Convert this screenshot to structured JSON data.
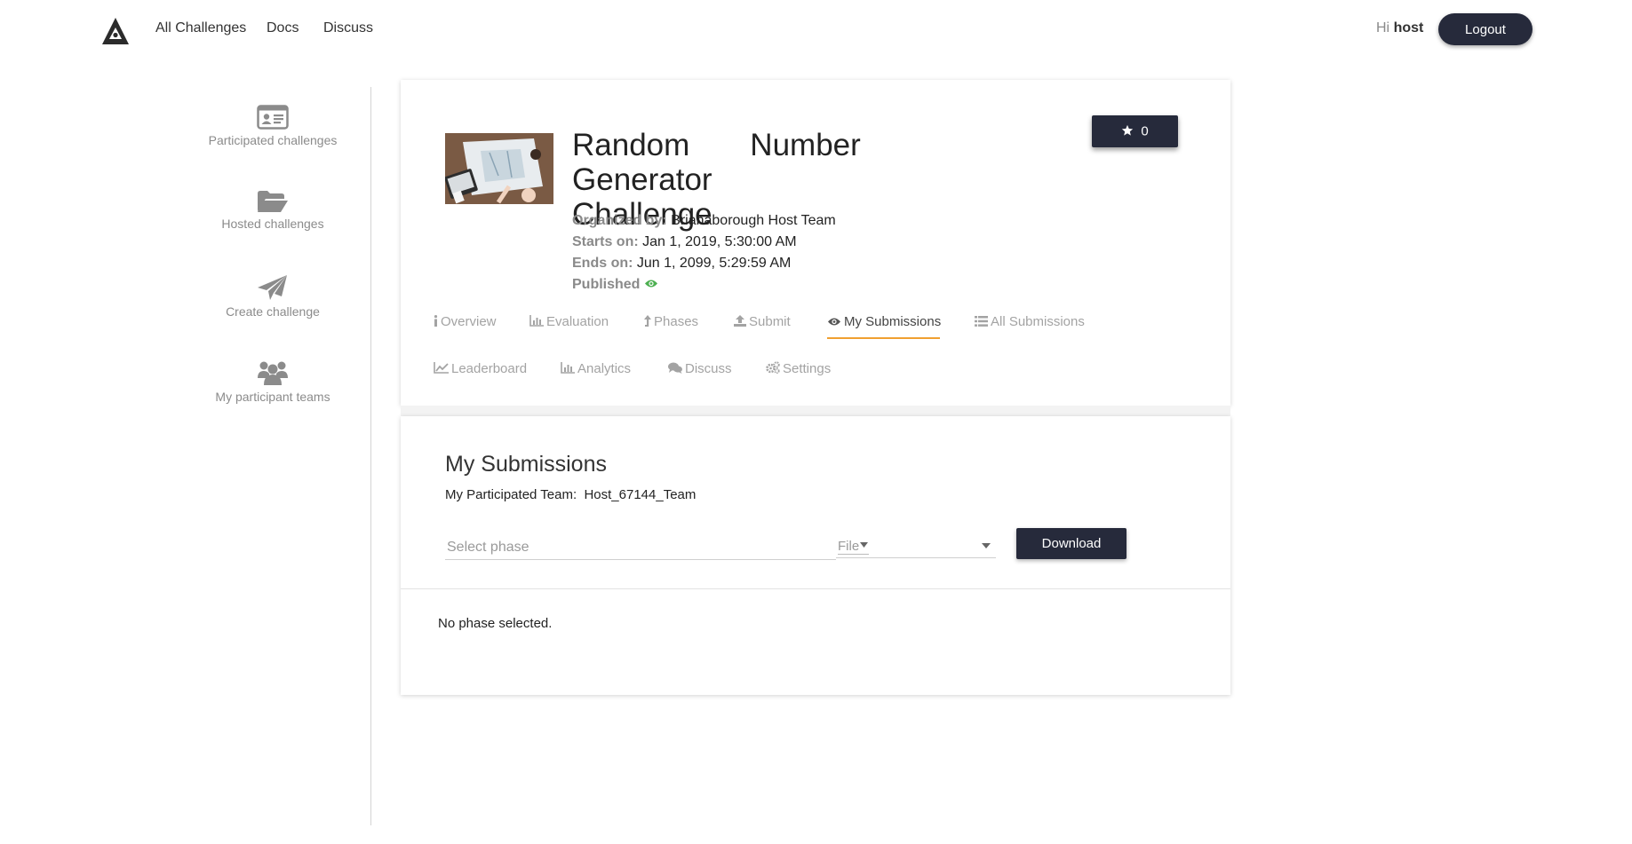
{
  "nav": {
    "links": [
      "All Challenges",
      "Docs",
      "Discuss"
    ],
    "greeting_prefix": "Hi",
    "username": "host",
    "logout_label": "Logout"
  },
  "sidebar": {
    "items": [
      {
        "label": "Participated challenges",
        "icon": "id-card-icon"
      },
      {
        "label": "Hosted challenges",
        "icon": "folder-open-icon"
      },
      {
        "label": "Create challenge",
        "icon": "paper-plane-icon"
      },
      {
        "label": "My participant teams",
        "icon": "users-icon"
      }
    ]
  },
  "challenge": {
    "title_words": [
      "Random",
      "Number",
      "Generator",
      "Challenge"
    ],
    "organized_by_label": "Organized by:",
    "organized_by": "Brianaborough Host Team",
    "starts_label": "Starts on:",
    "starts_on": "Jan 1, 2019, 5:30:00 AM",
    "ends_label": "Ends on:",
    "ends_on": "Jun 1, 2099, 5:29:59 AM",
    "published_label": "Published",
    "star_count": "0"
  },
  "tabs": [
    {
      "label": "Overview",
      "icon": "info-icon"
    },
    {
      "label": "Evaluation",
      "icon": "bar-chart-icon"
    },
    {
      "label": "Phases",
      "icon": "level-up-icon"
    },
    {
      "label": "Submit",
      "icon": "upload-icon"
    },
    {
      "label": "My Submissions",
      "icon": "eye-icon",
      "active": true
    },
    {
      "label": "All Submissions",
      "icon": "list-icon"
    },
    {
      "label": "Leaderboard",
      "icon": "line-chart-icon"
    },
    {
      "label": "Analytics",
      "icon": "bar-chart-icon"
    },
    {
      "label": "Discuss",
      "icon": "comments-icon"
    },
    {
      "label": "Settings",
      "icon": "cogs-icon"
    }
  ],
  "submissions": {
    "title": "My Submissions",
    "team_label": "My Participated Team:",
    "team_name": "Host_67144_Team",
    "phase_placeholder": "Select phase",
    "file_placeholder": "File",
    "download_label": "Download",
    "empty_message": "No phase selected."
  },
  "colors": {
    "primary_dark": "#262a3b",
    "active_tab_underline": "#f0a030",
    "published_eye": "#4caf50"
  }
}
